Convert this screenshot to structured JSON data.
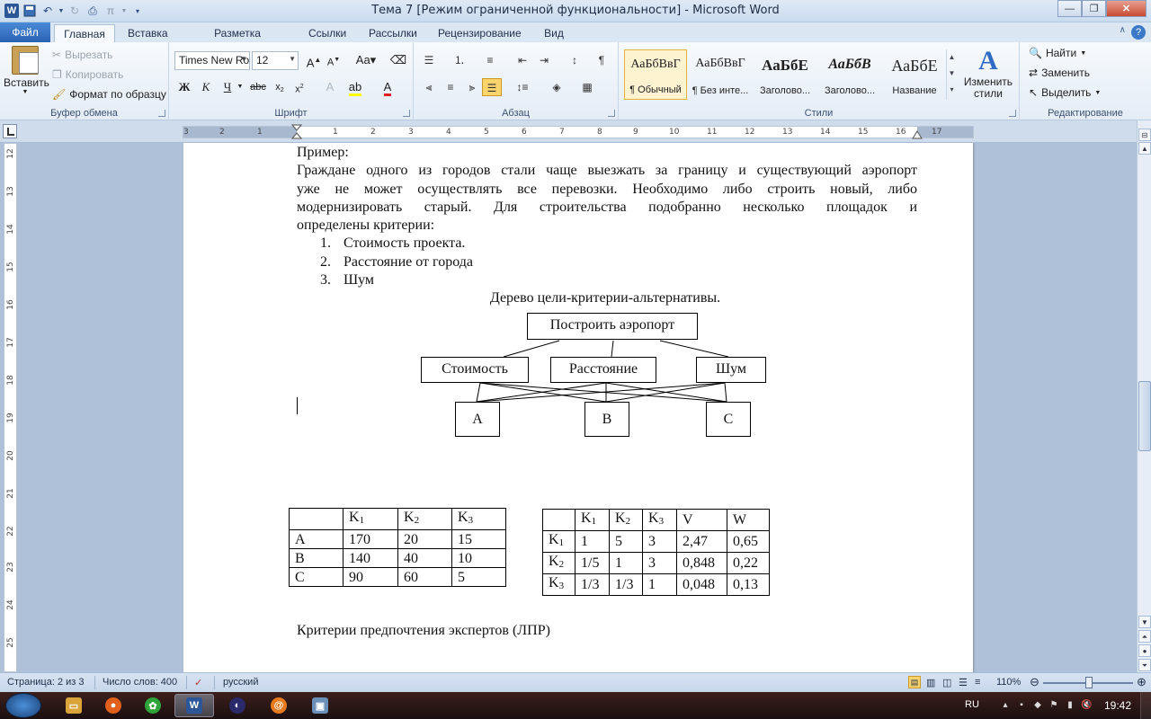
{
  "window": {
    "title": "Тема 7 [Режим ограниченной функциональности]  -  Microsoft Word"
  },
  "tabs": {
    "file": "Файл",
    "items": [
      "Главная",
      "Вставка",
      "Разметка страницы",
      "Ссылки",
      "Рассылки",
      "Рецензирование",
      "Вид"
    ]
  },
  "ribbon": {
    "clipboard": {
      "paste": "Вставить",
      "cut": "Вырезать",
      "copy": "Копировать",
      "format_painter": "Формат по образцу",
      "label": "Буфер обмена"
    },
    "font": {
      "font_name": "Times New Ro",
      "font_size": "12",
      "label": "Шрифт"
    },
    "paragraph": {
      "label": "Абзац"
    },
    "styles": {
      "items": [
        {
          "preview": "АаБбВвГ",
          "name": "¶ Обычный"
        },
        {
          "preview": "АаБбВвГ",
          "name": "¶ Без инте..."
        },
        {
          "preview": "АаБбЕ",
          "name": "Заголово..."
        },
        {
          "preview": "АаБбВ",
          "name": "Заголово..."
        },
        {
          "preview": "АаБбЕ",
          "name": "Название"
        }
      ],
      "change_styles": "Изменить стили",
      "label": "Стили"
    },
    "editing": {
      "find": "Найти",
      "replace": "Заменить",
      "select": "Выделить",
      "label": "Редактирование"
    }
  },
  "ruler": {
    "h_ticks": [
      "3",
      "2",
      "1",
      "1",
      "2",
      "3",
      "4",
      "5",
      "6",
      "7",
      "8",
      "9",
      "10",
      "11",
      "12",
      "13",
      "14",
      "15",
      "16",
      "17"
    ],
    "v_ticks": [
      "12",
      "13",
      "14",
      "15",
      "16",
      "17",
      "18",
      "19",
      "20",
      "21",
      "22",
      "23",
      "24",
      "25"
    ]
  },
  "document": {
    "example_heading": "Пример:",
    "paragraph_lines": [
      "Граждане одного из городов стали чаще выезжать за границу и существующий аэропорт",
      "уже не может осуществлять все перевозки. Необходимо либо строить новый, либо",
      "модернизировать старый. Для строительства подобранно несколько площадок и"
    ],
    "paragraph_last": "определены критерии:",
    "criteria": [
      {
        "num": "1.",
        "text": "Стоимость проекта."
      },
      {
        "num": "2.",
        "text": "Расстояние от города"
      },
      {
        "num": "3.",
        "text": "Шум"
      }
    ],
    "tree_caption": "Дерево цели-критерии-альтернативы.",
    "tree": {
      "goal": "Построить аэропорт",
      "criteria": [
        "Стоимость",
        "Расстояние",
        "Шум"
      ],
      "alternatives": [
        "A",
        "B",
        "C"
      ]
    },
    "table1": {
      "header": [
        "",
        "K",
        "K",
        "K"
      ],
      "header_sub": [
        "",
        "1",
        "2",
        "3"
      ],
      "rows": [
        [
          "A",
          "170",
          "20",
          "15"
        ],
        [
          "B",
          "140",
          "40",
          "10"
        ],
        [
          "C",
          "90",
          "60",
          "5"
        ]
      ]
    },
    "table2": {
      "header": [
        "",
        "K",
        "K",
        "K",
        "V",
        "W"
      ],
      "header_sub": [
        "",
        "1",
        "2",
        "3",
        "",
        ""
      ],
      "rows": [
        [
          "K",
          "1",
          "5",
          "3",
          "2,47",
          "0,65"
        ],
        [
          "K",
          "1/5",
          "1",
          "3",
          "0,848",
          "0,22"
        ],
        [
          "K",
          "1/3",
          "1/3",
          "1",
          "0,048",
          "0,13"
        ]
      ],
      "row_sub": [
        "1",
        "2",
        "3"
      ]
    },
    "footer_line": "Критерии предпочтения экспертов (ЛПР)"
  },
  "status": {
    "page": "Страница: 2 из 3",
    "words": "Число слов: 400",
    "language": "русский",
    "zoom": "110%",
    "zoom_level_pct": 110
  },
  "taskbar": {
    "lang": "RU",
    "clock": "19:42"
  }
}
